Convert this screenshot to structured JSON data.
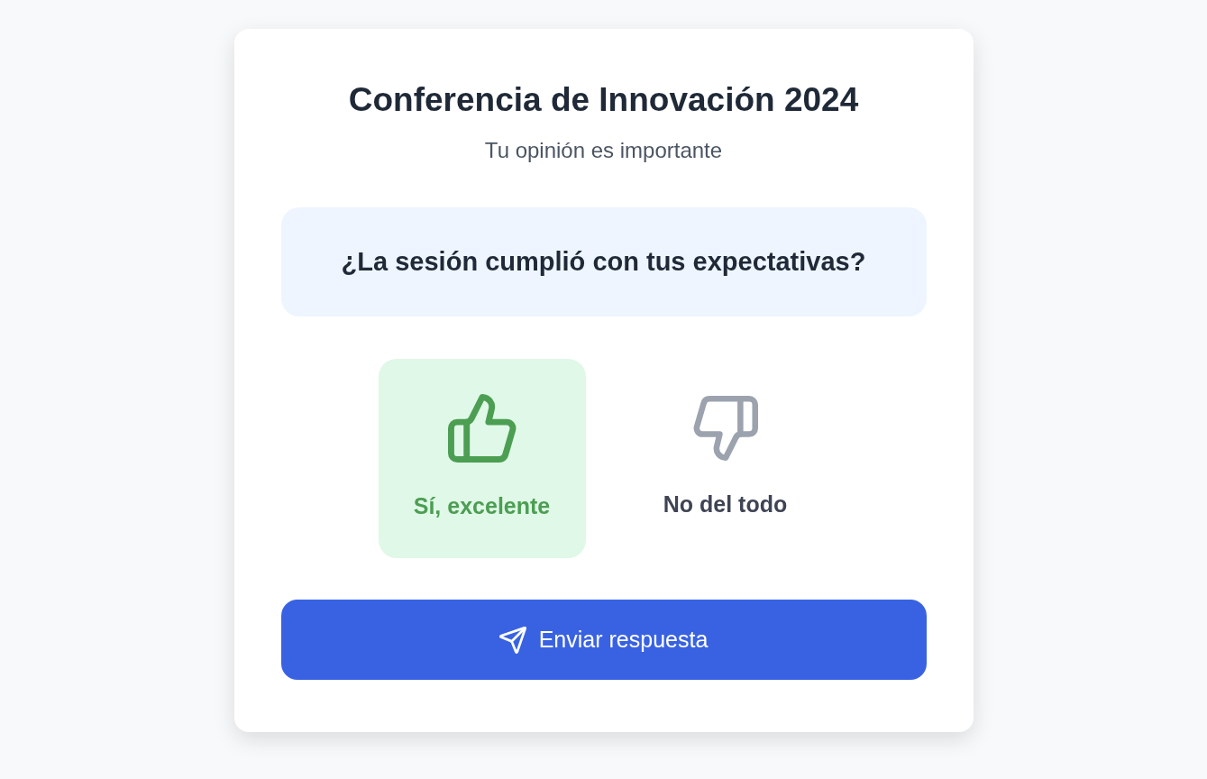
{
  "card": {
    "title": "Conferencia de Innovación 2024",
    "subtitle": "Tu opinión es importante"
  },
  "question": "¿La sesión cumplió con tus expectativas?",
  "options": [
    {
      "kind": "up",
      "label": "Sí, excelente",
      "selected": true
    },
    {
      "kind": "down",
      "label": "No del todo",
      "selected": false
    }
  ],
  "submit_button": {
    "label": "Enviar respuesta"
  }
}
